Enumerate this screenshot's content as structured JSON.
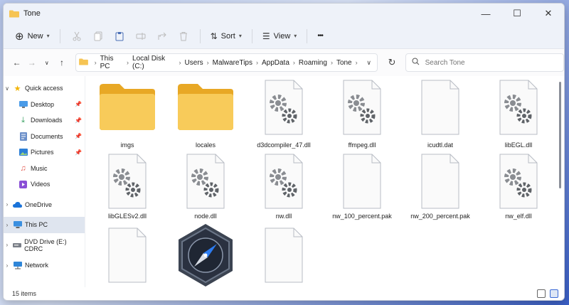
{
  "window": {
    "title": "Tone",
    "minimize": "—",
    "maximize": "☐",
    "close": "✕"
  },
  "toolbar": {
    "new_label": "New",
    "sort_label": "Sort",
    "view_label": "View",
    "more_label": "•••"
  },
  "address": {
    "crumbs": [
      "This PC",
      "Local Disk (C:)",
      "Users",
      "MalwareTips",
      "AppData",
      "Roaming",
      "Tone"
    ],
    "search_placeholder": "Search Tone"
  },
  "sidebar": {
    "items": [
      {
        "label": "Quick access",
        "icon": "star-icon"
      },
      {
        "label": "Desktop",
        "icon": "desktop-icon"
      },
      {
        "label": "Downloads",
        "icon": "download-icon"
      },
      {
        "label": "Documents",
        "icon": "documents-icon"
      },
      {
        "label": "Pictures",
        "icon": "pictures-icon"
      },
      {
        "label": "Music",
        "icon": "music-icon"
      },
      {
        "label": "Videos",
        "icon": "videos-icon"
      },
      {
        "label": "OneDrive",
        "icon": "cloud-icon"
      },
      {
        "label": "This PC",
        "icon": "pc-icon"
      },
      {
        "label": "DVD Drive (E:) CDRC",
        "icon": "dvd-icon"
      },
      {
        "label": "Network",
        "icon": "network-icon"
      }
    ]
  },
  "files": [
    {
      "name": "imgs",
      "type": "folder"
    },
    {
      "name": "locales",
      "type": "folder"
    },
    {
      "name": "d3dcompiler_47.dll",
      "type": "dll"
    },
    {
      "name": "ffmpeg.dll",
      "type": "dll"
    },
    {
      "name": "icudtl.dat",
      "type": "file"
    },
    {
      "name": "libEGL.dll",
      "type": "dll"
    },
    {
      "name": "libGLESv2.dll",
      "type": "dll"
    },
    {
      "name": "node.dll",
      "type": "dll"
    },
    {
      "name": "nw.dll",
      "type": "dll"
    },
    {
      "name": "nw_100_percent.pak",
      "type": "file"
    },
    {
      "name": "nw_200_percent.pak",
      "type": "file"
    },
    {
      "name": "nw_elf.dll",
      "type": "dll"
    },
    {
      "name": "",
      "type": "file"
    },
    {
      "name": "",
      "type": "app"
    },
    {
      "name": "",
      "type": "dll"
    }
  ],
  "status": {
    "items_count": "15 items"
  },
  "colors": {
    "accent": "#3a6ad6",
    "folder": "#f6c453",
    "folder_dark": "#e8a825"
  }
}
